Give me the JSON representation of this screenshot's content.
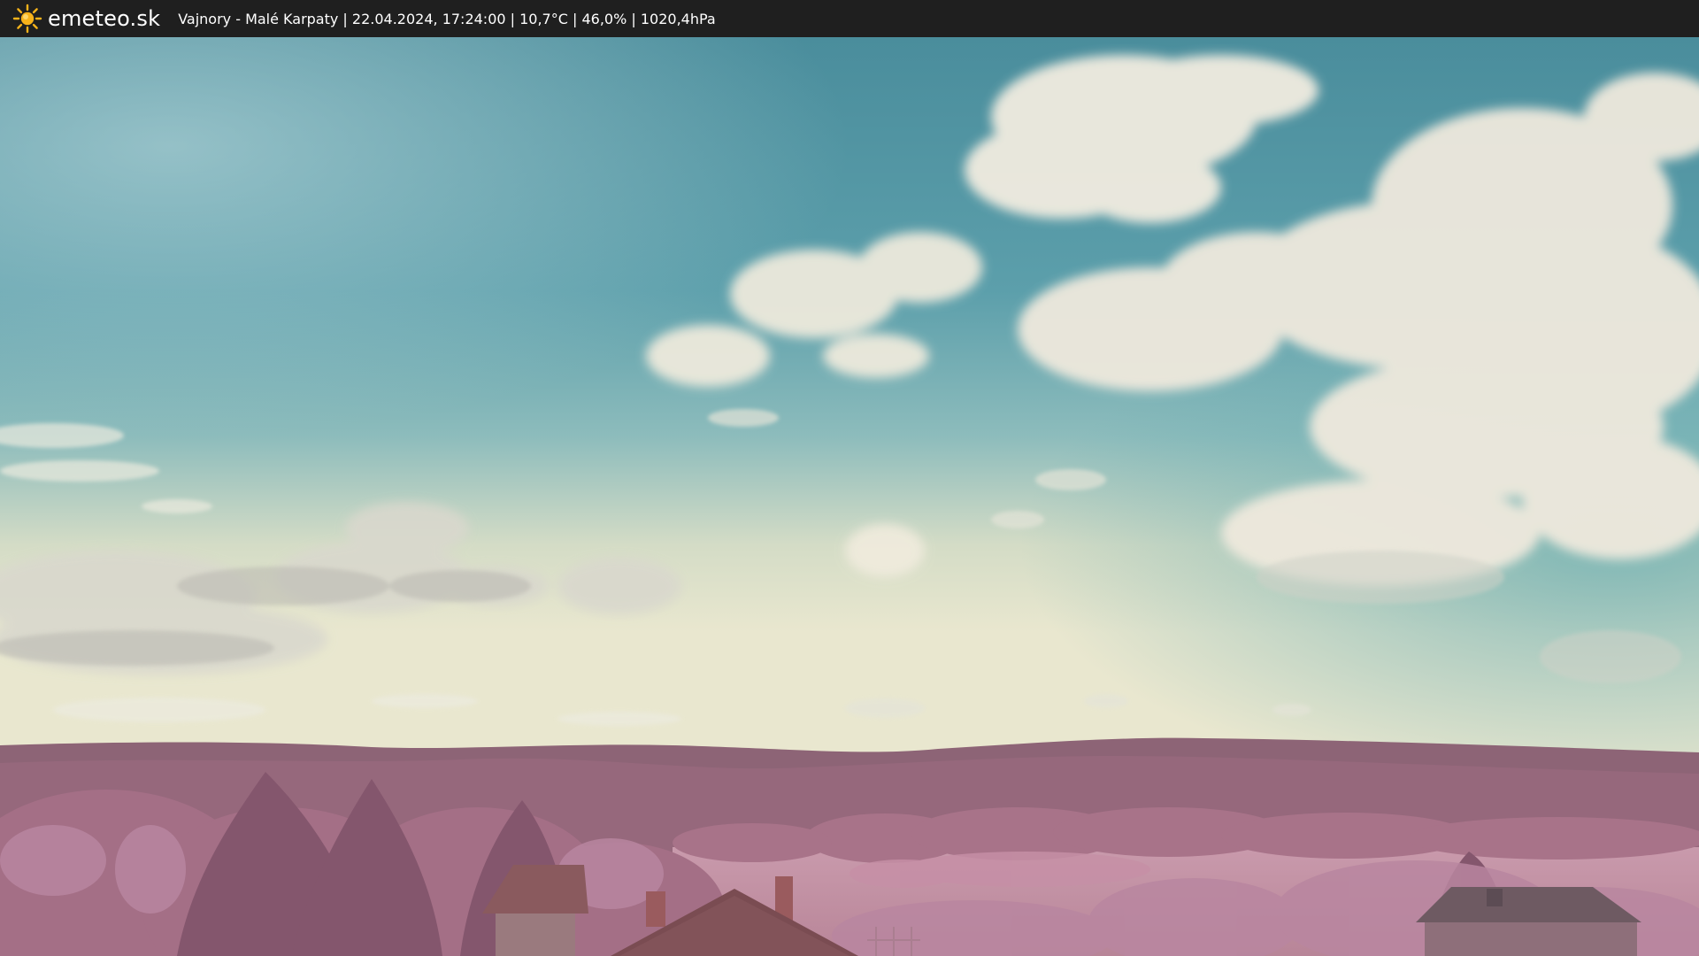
{
  "header": {
    "brand": "emeteo.sk",
    "brand_icon": "sun-icon",
    "caption": "Vajnory - Malé Karpaty | 22.04.2024, 17:24:00 | 10,7°C | 46,0% | 1020,4hPa"
  },
  "colors": {
    "bar_background": "#1f1f1f",
    "sun": "#f7b21a",
    "sky_top": "#4f93a2",
    "sky_horizon": "#e6e6cc",
    "hills": "#8a5d6f",
    "foliage": "#b07a95"
  }
}
